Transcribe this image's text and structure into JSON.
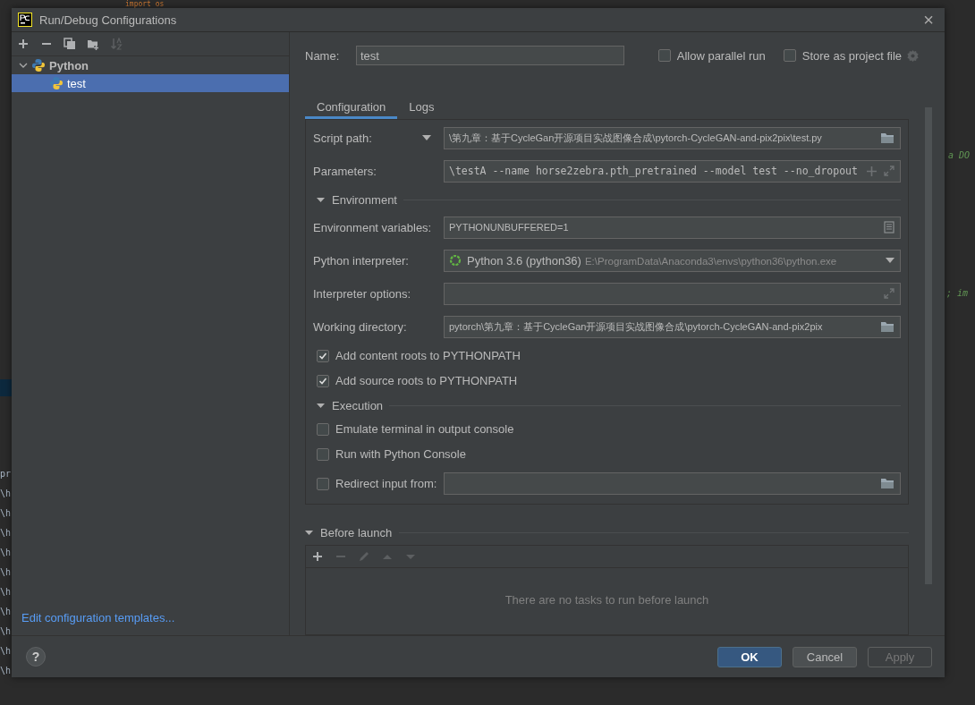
{
  "editor": {
    "top_line": "import os",
    "right_fragments": [
      "a DO",
      "; im"
    ],
    "left_fragments": [
      "pr",
      "\\h",
      "\\h",
      "\\h",
      "\\h",
      "\\h",
      "\\h",
      "\\h",
      "\\h",
      "\\h",
      "\\h"
    ]
  },
  "window": {
    "title": "Run/Debug Configurations",
    "close": "×"
  },
  "sidebar": {
    "toolbar": [
      {
        "kind": "add",
        "disabled": false
      },
      {
        "kind": "remove",
        "disabled": false
      },
      {
        "kind": "copy",
        "disabled": false
      },
      {
        "kind": "folder",
        "disabled": false
      },
      {
        "kind": "sort",
        "disabled": true
      }
    ],
    "tree": [
      {
        "label": "Python",
        "expanded": true,
        "selected": false,
        "children": [
          {
            "label": "test",
            "selected": true
          }
        ]
      }
    ],
    "link": "Edit configuration templates..."
  },
  "name_row": {
    "label": "Name:",
    "value": "test",
    "options": [
      {
        "label": "Allow parallel run",
        "checked": false
      },
      {
        "label": "Store as project file",
        "checked": false
      }
    ]
  },
  "tabs": [
    {
      "label": "Configuration",
      "selected": true
    },
    {
      "label": "Logs",
      "selected": false
    }
  ],
  "fields": [
    {
      "kind": "script",
      "label": "Script path:",
      "value": "\\第九章：基于CycleGan开源项目实战图像合成\\pytorch-CycleGAN-and-pix2pix\\test.py"
    },
    {
      "kind": "params",
      "label": "Parameters:",
      "value": "\\testA --name horse2zebra.pth_pretrained --model test --no_dropout"
    }
  ],
  "sections": [
    {
      "title": "Environment",
      "expanded": true,
      "fields": [
        {
          "kind": "env",
          "label": "Environment variables:",
          "value": "PYTHONUNBUFFERED=1"
        },
        {
          "kind": "interpreter",
          "label": "Python interpreter:",
          "value": "Python 3.6 (python36)",
          "path": "E:\\ProgramData\\Anaconda3\\envs\\python36\\python.exe"
        },
        {
          "kind": "options",
          "label": "Interpreter options:"
        },
        {
          "kind": "directory",
          "label": "Working directory:",
          "value": "pytorch\\第九章：基于CycleGan开源项目实战图像合成\\pytorch-CycleGAN-and-pix2pix"
        }
      ],
      "checks": [
        {
          "kind": "plain",
          "label": "Add content roots to PYTHONPATH",
          "checked": true
        },
        {
          "kind": "plain",
          "label": "Add source roots to PYTHONPATH",
          "checked": true
        }
      ]
    },
    {
      "title": "Execution",
      "expanded": true,
      "checks": [
        {
          "kind": "plain",
          "label": "Emulate terminal in output console",
          "checked": false
        },
        {
          "kind": "plain",
          "label": "Run with Python Console",
          "checked": false
        },
        {
          "kind": "with-field",
          "label": "Redirect input from:",
          "checked": false
        }
      ]
    }
  ],
  "before_launch": {
    "title": "Before launch",
    "expanded": true,
    "toolbar": [
      {
        "kind": "add",
        "disabled": false
      },
      {
        "kind": "remove",
        "disabled": true
      },
      {
        "kind": "edit",
        "disabled": true
      },
      {
        "kind": "up",
        "disabled": true
      },
      {
        "kind": "down",
        "disabled": true
      }
    ],
    "empty_text": "There are no tasks to run before launch"
  },
  "footer": {
    "help": "?",
    "buttons": [
      {
        "label": "OK",
        "kind": "primary",
        "disabled": false
      },
      {
        "label": "Cancel",
        "kind": "normal",
        "disabled": false
      },
      {
        "label": "Apply",
        "kind": "normal",
        "disabled": true
      }
    ]
  }
}
